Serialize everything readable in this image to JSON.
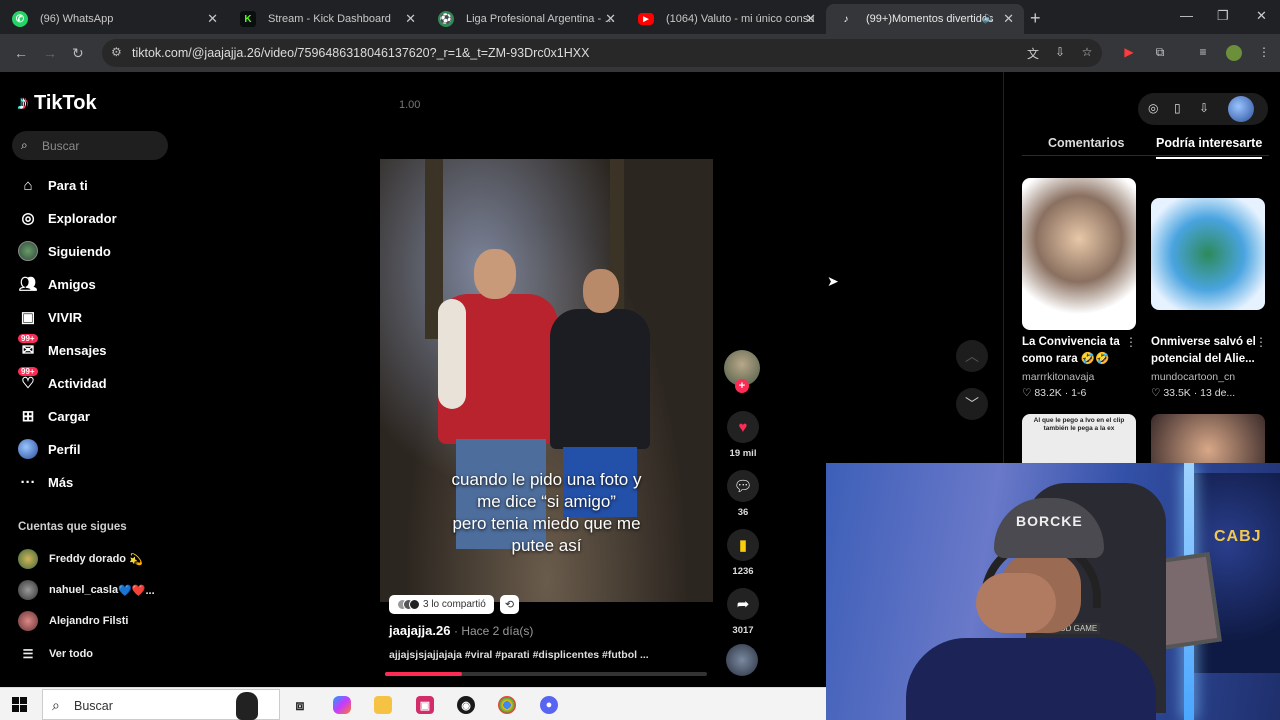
{
  "browser": {
    "tabs": [
      {
        "title": "(96) WhatsApp",
        "favicon": "whatsapp-icon",
        "color": "#25d366"
      },
      {
        "title": "Stream - Kick Dashboard",
        "favicon": "kick-icon",
        "color": "#53fc18"
      },
      {
        "title": "Liga Profesional Argentina - PO",
        "favicon": "soccer-ball-icon",
        "color": "#2e8b57"
      },
      {
        "title": "(1064) Valuto - mi único consu",
        "favicon": "youtube-icon",
        "color": "#ff0000"
      },
      {
        "title": "(99+)Momentos divertidos",
        "favicon": "tiktok-icon",
        "color": "#ffffff"
      }
    ],
    "url": "tiktok.com/@jaajajja.26/video/7596486318046137620?_r=1&_t=ZM-93Drc0x1HXX"
  },
  "sidebar": {
    "brand": "TikTok",
    "search_placeholder": "Buscar",
    "nav": [
      {
        "label": "Para ti",
        "icon": "home-icon"
      },
      {
        "label": "Explorador",
        "icon": "compass-icon"
      },
      {
        "label": "Siguiendo",
        "icon": "following-avatar-icon"
      },
      {
        "label": "Amigos",
        "icon": "friends-icon"
      },
      {
        "label": "VIVIR",
        "icon": "live-icon"
      },
      {
        "label": "Mensajes",
        "icon": "messages-icon",
        "badge": "99+"
      },
      {
        "label": "Actividad",
        "icon": "activity-icon",
        "badge": "99+"
      },
      {
        "label": "Cargar",
        "icon": "upload-icon"
      },
      {
        "label": "Perfil",
        "icon": "profile-icon"
      },
      {
        "label": "Más",
        "icon": "more-icon"
      }
    ],
    "following_title": "Cuentas que sigues",
    "following": [
      {
        "name": "Freddy dorado",
        "suffix": "💫"
      },
      {
        "name": "nahuel_casla",
        "suffix": "💙❤️..."
      },
      {
        "name": "Alejandro Filsti",
        "suffix": ""
      }
    ],
    "see_all": "Ver todo"
  },
  "video": {
    "speed": "1.00",
    "caption_lines": [
      "cuando le pido una foto y",
      "me dice “si amigo”",
      "pero tenia miedo que me",
      "putee así"
    ],
    "shared_text": "3 lo compartió",
    "author": "jaajajja.26",
    "posted": "· Hace 2 día(s)",
    "description": "ajjajsjsjajjajaja #viral #parati #displicentes #futbol ...",
    "progress": 0.24
  },
  "actions": {
    "likes": "19 mil",
    "comments": "36",
    "saves": "1236",
    "shares": "3017"
  },
  "right_panel": {
    "tabs": [
      "Comentarios",
      "Podría interesarte"
    ],
    "active_tab": "Podría interesarte",
    "recommendations": [
      {
        "title": "La Convivencia ta como rara 🤣🤣",
        "author": "marrrkitonavaja",
        "likes": "83.2K",
        "date": "1-6"
      },
      {
        "title": "Onmiverse salvó el potencial del Alie...",
        "author": "mundocartoon_cn",
        "likes": "33.5K",
        "date": "13 de..."
      }
    ],
    "third_thumb_text": "Al que le pego a Ivo en el clip también le pega a la ex"
  },
  "webcam": {
    "hat_text": "BORCKE",
    "flag_text": "CABJ",
    "tag_text": "GOOD GAME"
  },
  "taskbar": {
    "search_placeholder": "Buscar"
  },
  "colors": {
    "accent": "#fe2c55",
    "save": "#facd0c"
  }
}
